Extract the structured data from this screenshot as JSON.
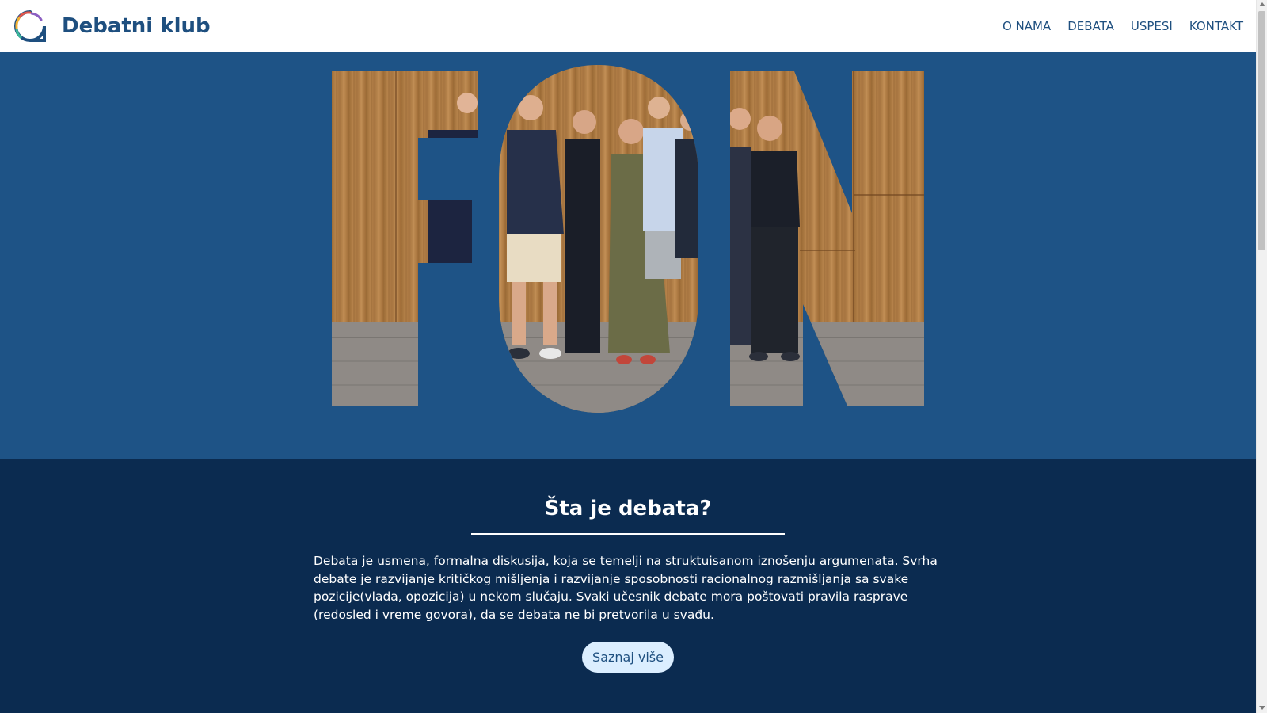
{
  "header": {
    "logo_icon": "debate-club-logo-icon",
    "brand_name": "Debatni klub",
    "nav": [
      "O NAMA",
      "DEBATA",
      "USPESI",
      "KONTAKT"
    ]
  },
  "hero": {
    "image": "FON letters filled with group photo of club members against wooden wall",
    "letters": [
      "F",
      "O",
      "N"
    ]
  },
  "about": {
    "title": "Šta je debata?",
    "text": "Debata je usmena, formalna diskusija, koja se temelji na struktuisanom iznošenju argumenata. Svrha debate je razvijanje kritičkog mišljenja i razvijanje sposobnosti racionalnog razmišljanja sa svake pozicije(vlada, opozicija) u nekom slučaju. Svaki učesnik debate mora poštovati pravila rasprave (redosled i vreme govora), da se debata ne bi pretvorila u svađu.",
    "button": "Saznaj više"
  },
  "colors": {
    "header_bg": "#ffffff",
    "brand_text": "#1e4f7f",
    "hero_bg": "#1e5386",
    "section_bg": "#0b2b50",
    "button_bg": "#dbeeff"
  }
}
